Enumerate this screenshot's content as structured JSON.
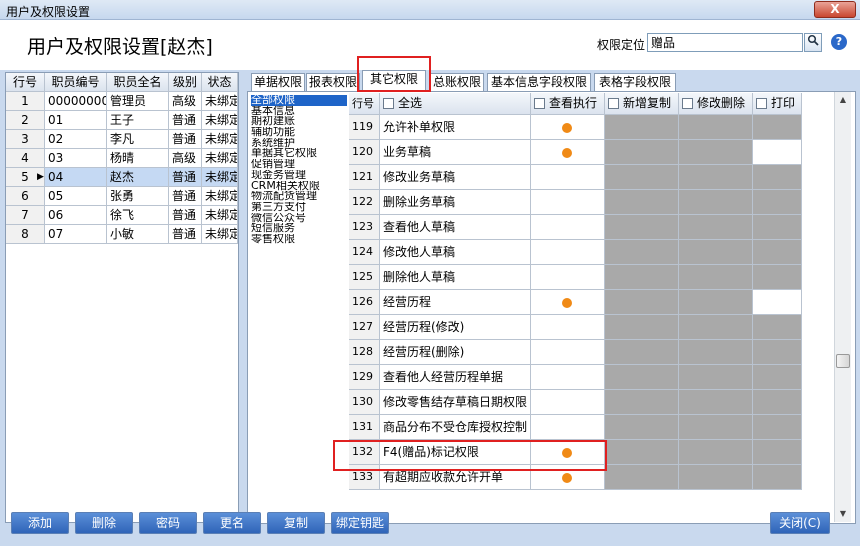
{
  "window": {
    "title": "用户及权限设置",
    "close_label": "X"
  },
  "header": {
    "title": "用户及权限设置[赵杰]"
  },
  "locate": {
    "label": "权限定位",
    "value": "赠品",
    "button_icon": "search-icon",
    "help_icon": "help-icon"
  },
  "employees": {
    "columns": [
      "行号",
      "职员编号",
      "职员全名",
      "级别",
      "状态"
    ],
    "rows": [
      {
        "n": "1",
        "code": "000000000",
        "name": "管理员",
        "level": "高级",
        "status": "未绑定"
      },
      {
        "n": "2",
        "code": "01",
        "name": "王子",
        "level": "普通",
        "status": "未绑定"
      },
      {
        "n": "3",
        "code": "02",
        "name": "李凡",
        "level": "普通",
        "status": "未绑定"
      },
      {
        "n": "4",
        "code": "03",
        "name": "杨晴",
        "level": "高级",
        "status": "未绑定"
      },
      {
        "n": "5",
        "code": "04",
        "name": "赵杰",
        "level": "普通",
        "status": "未绑定",
        "selected": true
      },
      {
        "n": "6",
        "code": "05",
        "name": "张勇",
        "level": "普通",
        "status": "未绑定"
      },
      {
        "n": "7",
        "code": "06",
        "name": "徐飞",
        "level": "普通",
        "status": "未绑定"
      },
      {
        "n": "8",
        "code": "07",
        "name": "小敏",
        "level": "普通",
        "status": "未绑定"
      }
    ]
  },
  "tabs": [
    {
      "label": "单据权限"
    },
    {
      "label": "报表权限"
    },
    {
      "label": "其它权限",
      "active": true
    },
    {
      "label": "总账权限"
    },
    {
      "label": "基本信息字段权限"
    },
    {
      "label": "表格字段权限"
    }
  ],
  "categories": [
    "全部权限",
    "基本信息",
    "期初建账",
    "辅助功能",
    "系统维护",
    "单据其它权限",
    "促销管理",
    "现金务管理",
    "CRM相关权限",
    "物流配货管理",
    "第三方支付",
    "微信公众号",
    "短信服务",
    "零售权限"
  ],
  "perm_columns": {
    "row_no": "行号",
    "select_all": "全选",
    "view": "查看执行",
    "add_copy": "新增复制",
    "edit_delete": "修改删除",
    "print": "打印"
  },
  "perms": [
    {
      "n": "119",
      "name": "允许补单权限",
      "dot": true,
      "print": "gray"
    },
    {
      "n": "120",
      "name": "业务草稿",
      "dot": true,
      "print": "white"
    },
    {
      "n": "121",
      "name": "修改业务草稿",
      "dot": false,
      "print": "gray"
    },
    {
      "n": "122",
      "name": "删除业务草稿",
      "dot": false,
      "print": "gray"
    },
    {
      "n": "123",
      "name": "查看他人草稿",
      "dot": false,
      "print": "gray"
    },
    {
      "n": "124",
      "name": "修改他人草稿",
      "dot": false,
      "print": "gray"
    },
    {
      "n": "125",
      "name": "删除他人草稿",
      "dot": false,
      "print": "gray"
    },
    {
      "n": "126",
      "name": "经营历程",
      "dot": true,
      "print": "white"
    },
    {
      "n": "127",
      "name": "经营历程(修改)",
      "dot": false,
      "print": "gray"
    },
    {
      "n": "128",
      "name": "经营历程(删除)",
      "dot": false,
      "print": "gray"
    },
    {
      "n": "129",
      "name": "查看他人经营历程单据",
      "dot": false,
      "print": "gray"
    },
    {
      "n": "130",
      "name": "修改零售结存草稿日期权限",
      "dot": false,
      "print": "gray"
    },
    {
      "n": "131",
      "name": "商品分布不受仓库授权控制",
      "dot": false,
      "print": "gray"
    },
    {
      "n": "132",
      "name": "F4(赠品)标记权限",
      "dot": true,
      "print": "gray"
    },
    {
      "n": "133",
      "name": "有超期应收款允许开单",
      "dot": true,
      "print": "gray"
    }
  ],
  "footer": {
    "add": "添加",
    "delete": "删除",
    "password": "密码",
    "rename": "更名",
    "copy": "复制",
    "bind_key": "绑定钥匙",
    "close": "关闭(C)"
  },
  "colors": {
    "highlight": "#e02020",
    "dot": "#f08a16",
    "selected_row": "#c5d9f3",
    "disabled_cell": "#a9a9a9"
  }
}
